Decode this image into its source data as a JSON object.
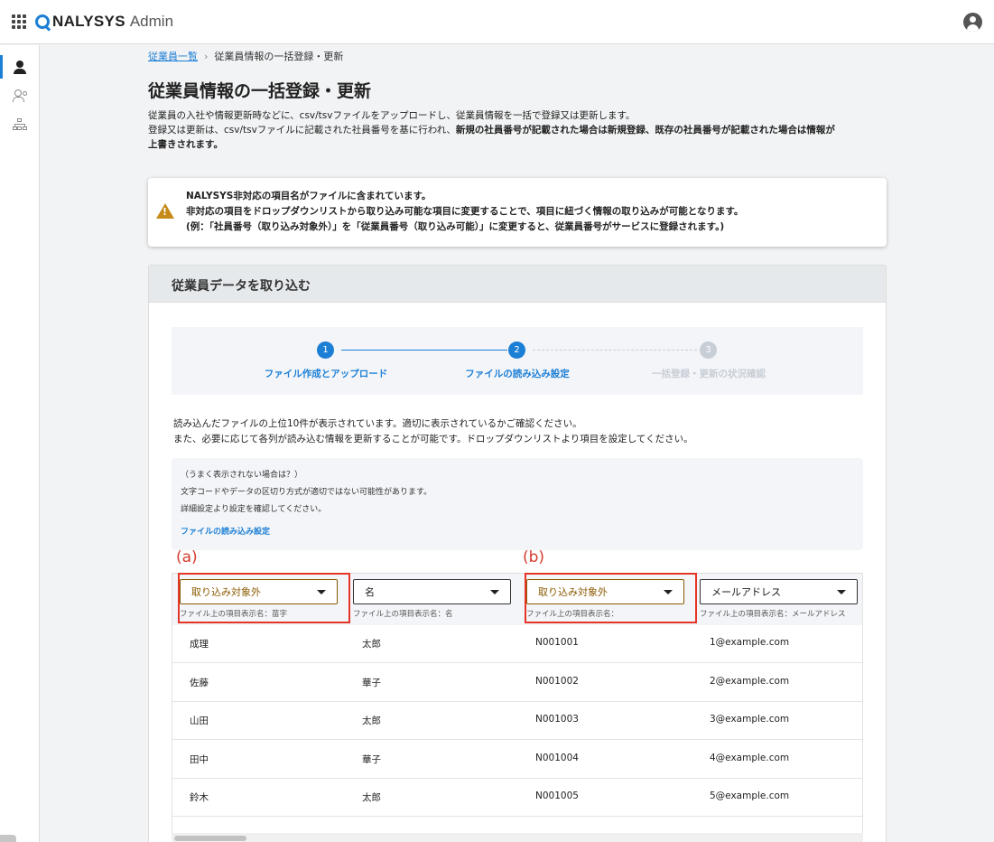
{
  "app": {
    "brand": "NALYSYS",
    "brand_suffix": "Admin"
  },
  "breadcrumb": {
    "parent": "従業員一覧",
    "current": "従業員情報の一括登録・更新"
  },
  "page": {
    "title": "従業員情報の一括登録・更新",
    "desc_line1": "従業員の入社や情報更新時などに、csv/tsvファイルをアップロードし、従業員情報を一括で登録又は更新します。",
    "desc_line2_plain": "登録又は更新は、csv/tsvファイルに記載された社員番号を基に行われ、",
    "desc_line2_bold": "新規の社員番号が記載された場合は新規登録、既存の社員番号が記載された場合は情報が",
    "desc_line3_bold": "上書きされます。"
  },
  "alert": {
    "line1": "NALYSYS非対応の項目名がファイルに含まれています。",
    "line2": "非対応の項目をドロップダウンリストから取り込み可能な項目に変更することで、項目に紐づく情報の取り込みが可能となります。",
    "line3": "(例：「社員番号（取り込み対象外）」を「従業員番号（取り込み可能）」に変更すると、従業員番号がサービスに登録されます。)"
  },
  "card": {
    "title": "従業員データを取り込む",
    "steps": [
      {
        "num": "1",
        "label": "ファイル作成とアップロード"
      },
      {
        "num": "2",
        "label": "ファイルの読み込み設定"
      },
      {
        "num": "3",
        "label": "一括登録・更新の状況確認"
      }
    ],
    "info_line1": "読み込んだファイルの上位10件が表示されています。適切に表示されているかご確認ください。",
    "info_line2": "また、必要に応じて各列が読み込む情報を更新することが可能です。ドロップダウンリストより項目を設定してください。",
    "hint": {
      "line1": "（うまく表示されない場合は？）",
      "line2": "文字コードやデータの区切り方式が適切ではない可能性があります。",
      "line3": "詳細設定より設定を確認してください。",
      "link": "ファイルの読み込み設定"
    },
    "annotations": {
      "a": "(a)",
      "b": "(b)"
    },
    "columns": [
      {
        "select": "取り込み対象外",
        "sub": "ファイル上の項目表示名：苗字"
      },
      {
        "select": "名",
        "sub": "ファイル上の項目表示名：名"
      },
      {
        "select": "取り込み対象外",
        "sub": "ファイル上の項目表示名："
      },
      {
        "select": "メールアドレス",
        "sub": "ファイル上の項目表示名：メールアドレス"
      }
    ],
    "rows": [
      [
        "成理",
        "太郎",
        "N001001",
        "1@example.com"
      ],
      [
        "佐藤",
        "華子",
        "N001002",
        "2@example.com"
      ],
      [
        "山田",
        "太郎",
        "N001003",
        "3@example.com"
      ],
      [
        "田中",
        "華子",
        "N001004",
        "4@example.com"
      ],
      [
        "鈴木",
        "太郎",
        "N001005",
        "5@example.com"
      ]
    ]
  },
  "colors": {
    "accent": "#1c7fd6",
    "warning": "#c58a17",
    "highlight": "#e53528"
  },
  "icons": [
    "apps-grid-icon",
    "account-icon",
    "person-icon",
    "people-icon",
    "org-chart-icon",
    "warning-icon",
    "chevron-right-icon",
    "caret-down-icon"
  ]
}
